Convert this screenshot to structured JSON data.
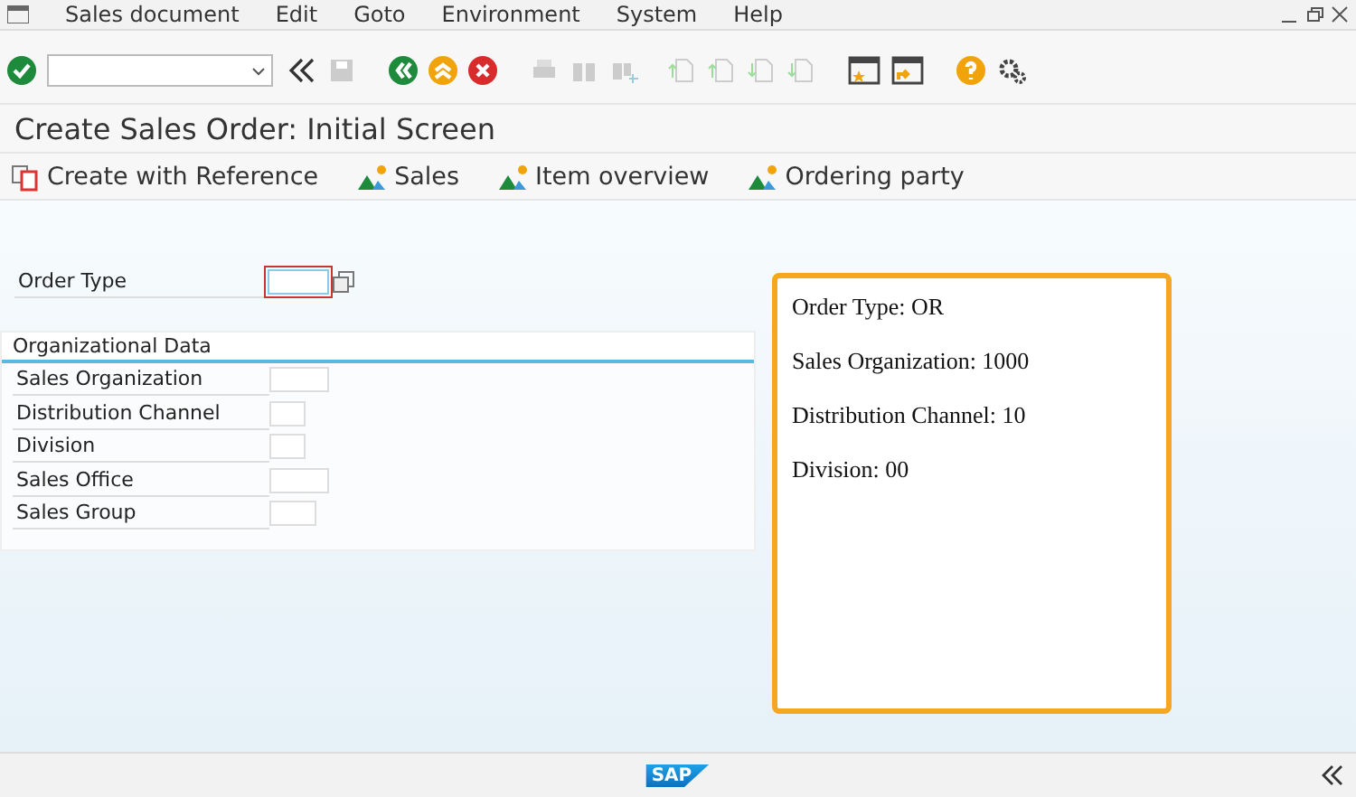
{
  "menu_bar": {
    "items": [
      "Sales document",
      "Edit",
      "Goto",
      "Environment",
      "System",
      "Help"
    ]
  },
  "window": {
    "title": "Create Sales Order: Initial Screen"
  },
  "app_toolbar": {
    "buttons": [
      {
        "label": "Create with Reference",
        "kind": "reference"
      },
      {
        "label": "Sales",
        "kind": "overview"
      },
      {
        "label": "Item overview",
        "kind": "overview"
      },
      {
        "label": "Ordering party",
        "kind": "overview"
      }
    ]
  },
  "order_type": {
    "label": "Order Type",
    "focused": true
  },
  "organizational_data": {
    "title": "Organizational Data",
    "fields": [
      {
        "label": "Sales Organization"
      },
      {
        "label": "Distribution Channel"
      },
      {
        "label": "Division"
      },
      {
        "label": "Sales Office"
      },
      {
        "label": "Sales Group"
      }
    ]
  },
  "note": {
    "lines": [
      "Order Type: OR",
      "Sales Organization: 1000",
      "Distribution Channel: 10",
      "Division: 00"
    ]
  },
  "status_bar": {
    "logo": "SAP"
  }
}
